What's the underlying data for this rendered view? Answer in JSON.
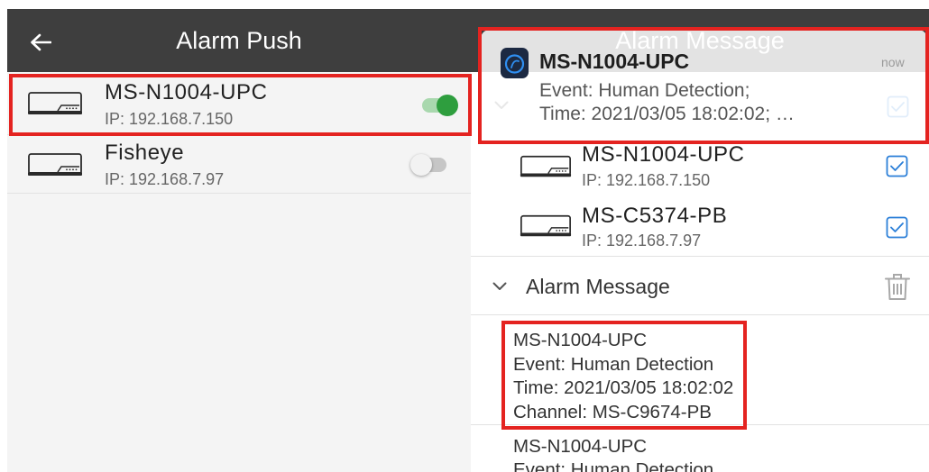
{
  "left_panel": {
    "header": {
      "title": "Alarm Push",
      "back_icon": "arrow-left-icon"
    },
    "devices": [
      {
        "icon": "nvr-device-icon",
        "name": "MS-N1004-UPC",
        "ip": "IP: 192.168.7.150",
        "alarm_push_enabled": true
      },
      {
        "icon": "nvr-device-icon",
        "name": "Fisheye",
        "ip": "IP: 192.168.7.97",
        "alarm_push_enabled": false
      }
    ]
  },
  "right_panel": {
    "header": {
      "title": "Alarm Message"
    },
    "device_section": {
      "expand_icon": "chevron-down-icon",
      "select_all_checked": true
    },
    "devices": [
      {
        "icon": "nvr-device-icon",
        "name": "MS-N1004-UPC",
        "ip": "IP: 192.168.7.150",
        "checked": true
      },
      {
        "icon": "nvr-device-icon",
        "name": "MS-C5374-PB",
        "ip": "IP: 192.168.7.97",
        "checked": true
      }
    ],
    "alarm_section": {
      "title": "Alarm Message",
      "expand_icon": "chevron-down-icon",
      "delete_icon": "trash-icon"
    },
    "messages": [
      {
        "device": "MS-N1004-UPC",
        "event": "Event: Human Detection",
        "time": "Time: 2021/03/05 18:02:02",
        "channel": "Channel: MS-C9674-PB"
      },
      {
        "device": "MS-N1004-UPC",
        "event": "Event: Human Detection"
      }
    ]
  },
  "notification": {
    "app_icon": "app-logo-icon",
    "title": "MS-N1004-UPC",
    "time": "now",
    "line1": "Event: Human Detection;",
    "line2": "Time: 2021/03/05 18:02:02; …"
  },
  "colors": {
    "header_bg": "#3e3e3e",
    "toggle_on_knob": "#2e9e3e",
    "toggle_on_track": "#a9d8ae",
    "toggle_off_track": "#c6c6c6",
    "checkbox_blue": "#2b7fd8",
    "highlight_red": "#e42320"
  }
}
